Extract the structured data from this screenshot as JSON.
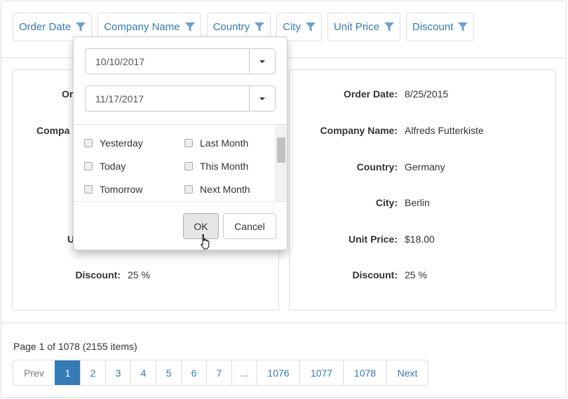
{
  "filters": [
    {
      "label": "Order Date",
      "icon": "filter-icon"
    },
    {
      "label": "Company Name",
      "icon": "filter-icon"
    },
    {
      "label": "Country",
      "icon": "filter-icon"
    },
    {
      "label": "City",
      "icon": "filter-icon"
    },
    {
      "label": "Unit Price",
      "icon": "filter-icon"
    },
    {
      "label": "Discount",
      "icon": "filter-icon"
    }
  ],
  "left_card": {
    "order_date_label": "Or",
    "company_label": "Compa",
    "unit_price_label": "U",
    "discount_label": "Discount:",
    "discount_value": "25 %"
  },
  "right_card": {
    "rows": [
      {
        "label": "Order Date:",
        "value": "8/25/2015"
      },
      {
        "label": "Company Name:",
        "value": "Alfreds Futterkiste"
      },
      {
        "label": "Country:",
        "value": "Germany"
      },
      {
        "label": "City:",
        "value": "Berlin"
      },
      {
        "label": "Unit Price:",
        "value": "$18.00"
      },
      {
        "label": "Discount:",
        "value": "25 %"
      }
    ]
  },
  "popup": {
    "from": "10/10/2017",
    "to": "11/17/2017",
    "options": [
      "Yesterday",
      "Today",
      "Tomorrow",
      "Last Month",
      "This Month",
      "Next Month"
    ],
    "ok": "OK",
    "cancel": "Cancel"
  },
  "pager": {
    "info": "Page 1 of 1078 (2155 items)",
    "pages": [
      "Prev",
      "1",
      "2",
      "3",
      "4",
      "5",
      "6",
      "7",
      "…",
      "1076",
      "1077",
      "1078",
      "Next"
    ],
    "active": "1",
    "accent": "#337ab7"
  }
}
